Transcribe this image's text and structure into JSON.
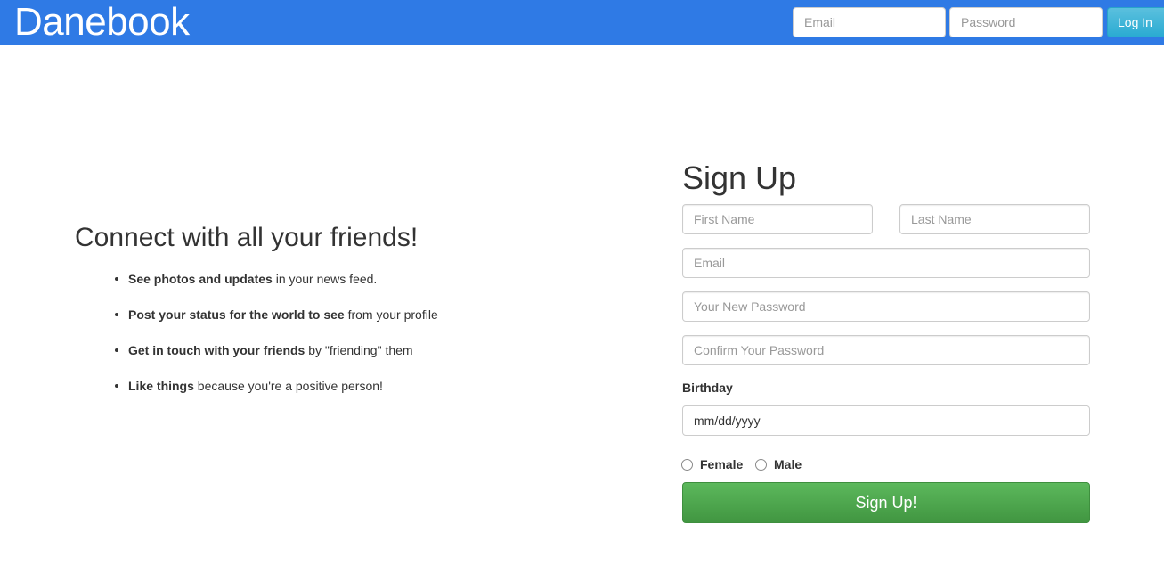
{
  "header": {
    "brand": "Danebook",
    "email_placeholder": "Email",
    "password_placeholder": "Password",
    "login_label": "Log In",
    "bar_color": "#2f7ae5"
  },
  "promo": {
    "title": "Connect with all your friends!",
    "features": [
      {
        "bold": "See photos and updates",
        "rest": " in your news feed."
      },
      {
        "bold": "Post your status for the world to see",
        "rest": " from your profile"
      },
      {
        "bold": "Get in touch with your friends",
        "rest": " by \"friending\" them"
      },
      {
        "bold": "Like things",
        "rest": " because you're a positive person!"
      }
    ]
  },
  "signup": {
    "title": "Sign Up",
    "first_name_placeholder": "First Name",
    "last_name_placeholder": "Last Name",
    "email_placeholder": "Email",
    "password_placeholder": "Your New Password",
    "confirm_placeholder": "Confirm Your Password",
    "birthday_label": "Birthday",
    "birthday_placeholder": "mm/dd/yyyy",
    "gender_female": "Female",
    "gender_male": "Male",
    "submit_label": "Sign Up!",
    "submit_color": "#5cb85c"
  }
}
